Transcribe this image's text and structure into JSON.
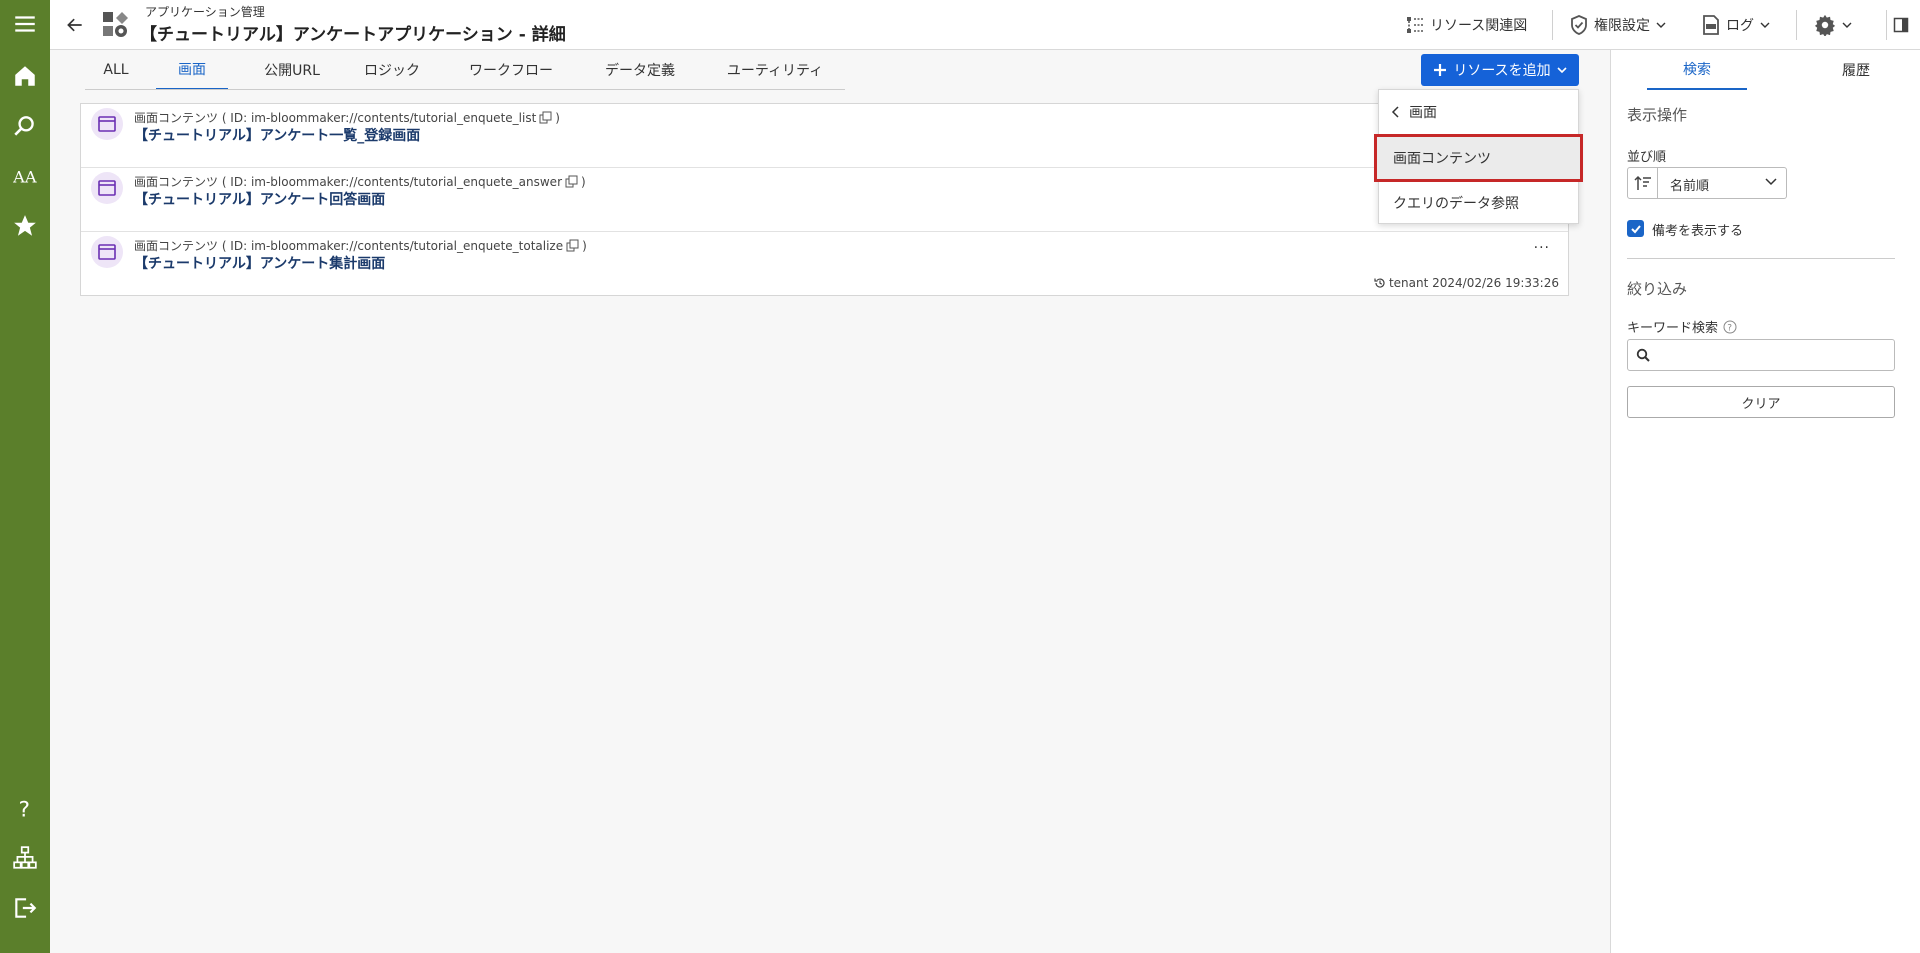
{
  "header": {
    "breadcrumb": "アプリケーション管理",
    "title": "【チュートリアル】アンケートアプリケーション - 詳細",
    "resource_map": "リソース関連図",
    "permissions": "権限設定",
    "log": "ログ"
  },
  "tabs": [
    {
      "label": "ALL"
    },
    {
      "label": "画面"
    },
    {
      "label": "公開URL"
    },
    {
      "label": "ロジック"
    },
    {
      "label": "ワークフロー"
    },
    {
      "label": "データ定義"
    },
    {
      "label": "ユーティリティ"
    }
  ],
  "add_button": "リソースを追加",
  "dropdown": {
    "back_label": "画面",
    "items": [
      "画面コンテンツ",
      "クエリのデータ参照"
    ]
  },
  "rows": [
    {
      "subtitle": "画面コンテンツ ( ID: im-bloommaker://contents/tutorial_enquete_list",
      "subtitle_close": ")",
      "title": "【チュートリアル】アンケート一覧_登録画面"
    },
    {
      "subtitle": "画面コンテンツ ( ID: im-bloommaker://contents/tutorial_enquete_answer",
      "subtitle_close": ")",
      "title": "【チュートリアル】アンケート回答画面"
    },
    {
      "subtitle": "画面コンテンツ ( ID: im-bloommaker://contents/tutorial_enquete_totalize",
      "subtitle_close": ")",
      "title": "【チュートリアル】アンケート集計画面",
      "more": "···",
      "meta": "tenant 2024/02/26 19:33:26"
    }
  ],
  "right_panel": {
    "tabs": [
      "検索",
      "履歴"
    ],
    "display_ops": "表示操作",
    "sort_label": "並び順",
    "sort_value": "名前順",
    "show_notes": "備考を表示する",
    "filter": "絞り込み",
    "keyword_label": "キーワード検索",
    "keyword_placeholder": "",
    "clear": "クリア"
  },
  "colors": {
    "rail": "#5b7f2b",
    "accent": "#1a65c7",
    "highlight_border": "#c62828"
  }
}
